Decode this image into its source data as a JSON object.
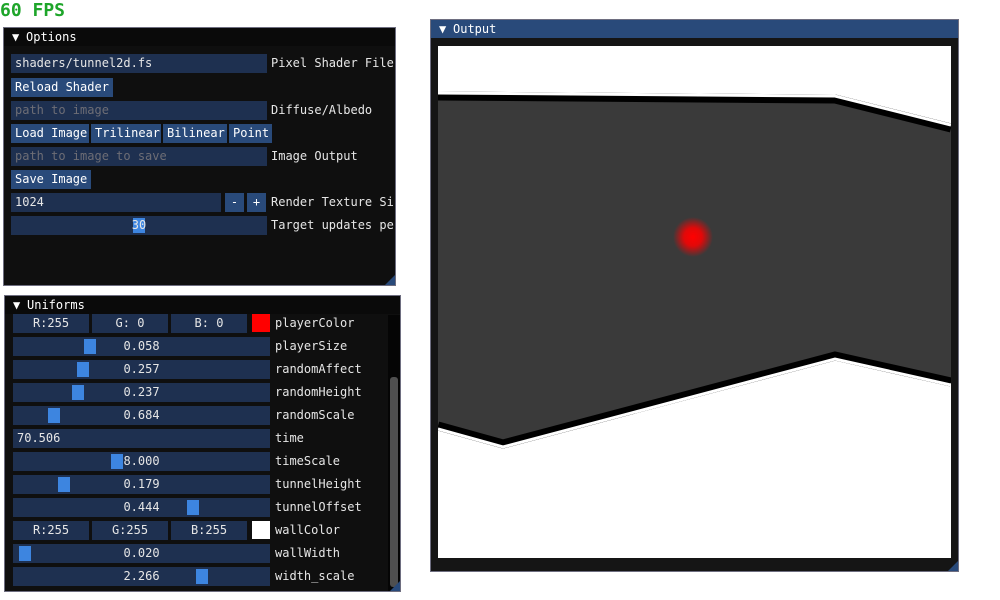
{
  "fps": {
    "text": "60 FPS",
    "color": "#1ea52a"
  },
  "options": {
    "title": "Options",
    "shader_file": {
      "value": "shaders/tunnel2d.fs",
      "label": "Pixel Shader File"
    },
    "reload_button": "Reload Shader",
    "diffuse": {
      "placeholder": "path to image",
      "label": "Diffuse/Albedo"
    },
    "load_buttons": [
      "Load Image",
      "Trilinear",
      "Bilinear",
      "Point"
    ],
    "image_output": {
      "placeholder": "path to image to save",
      "label": "Image Output"
    },
    "save_button": "Save Image",
    "render_size": {
      "value": "1024",
      "minus": "-",
      "plus": "+",
      "label": "Render Texture Size"
    },
    "target_updates": {
      "value": "30",
      "fraction": 0.5,
      "label": "Target updates per second"
    }
  },
  "uniforms": {
    "title": "Uniforms",
    "player_color": {
      "r": "R:255",
      "g": "G:  0",
      "b": "B:  0",
      "swatch": "#ff0000",
      "label": "playerColor"
    },
    "sliders": [
      {
        "value": "0.058",
        "fraction": 0.29,
        "label": "playerSize"
      },
      {
        "value": "0.257",
        "fraction": 0.26,
        "label": "randomAffect"
      },
      {
        "value": "0.237",
        "fraction": 0.24,
        "label": "randomHeight"
      },
      {
        "value": "0.684",
        "fraction": 0.14,
        "label": "randomScale"
      }
    ],
    "time": {
      "value": "70.506",
      "label": "time"
    },
    "sliders2": [
      {
        "value": "8.000",
        "fraction": 0.4,
        "label": "timeScale"
      },
      {
        "value": "0.179",
        "fraction": 0.18,
        "label": "tunnelHeight"
      },
      {
        "value": "0.444",
        "fraction": 0.71,
        "label": "tunnelOffset"
      }
    ],
    "wall_color": {
      "r": "R:255",
      "g": "G:255",
      "b": "B:255",
      "swatch": "#ffffff",
      "label": "wallColor"
    },
    "sliders3": [
      {
        "value": "0.020",
        "fraction": 0.02,
        "label": "wallWidth"
      },
      {
        "value": "2.266",
        "fraction": 0.75,
        "label": "width_scale"
      }
    ]
  },
  "output": {
    "title": "Output",
    "tunnel_color": "#3a3a3a",
    "wall_edge_color": "#ffffff",
    "player_color": "#ff0000"
  }
}
